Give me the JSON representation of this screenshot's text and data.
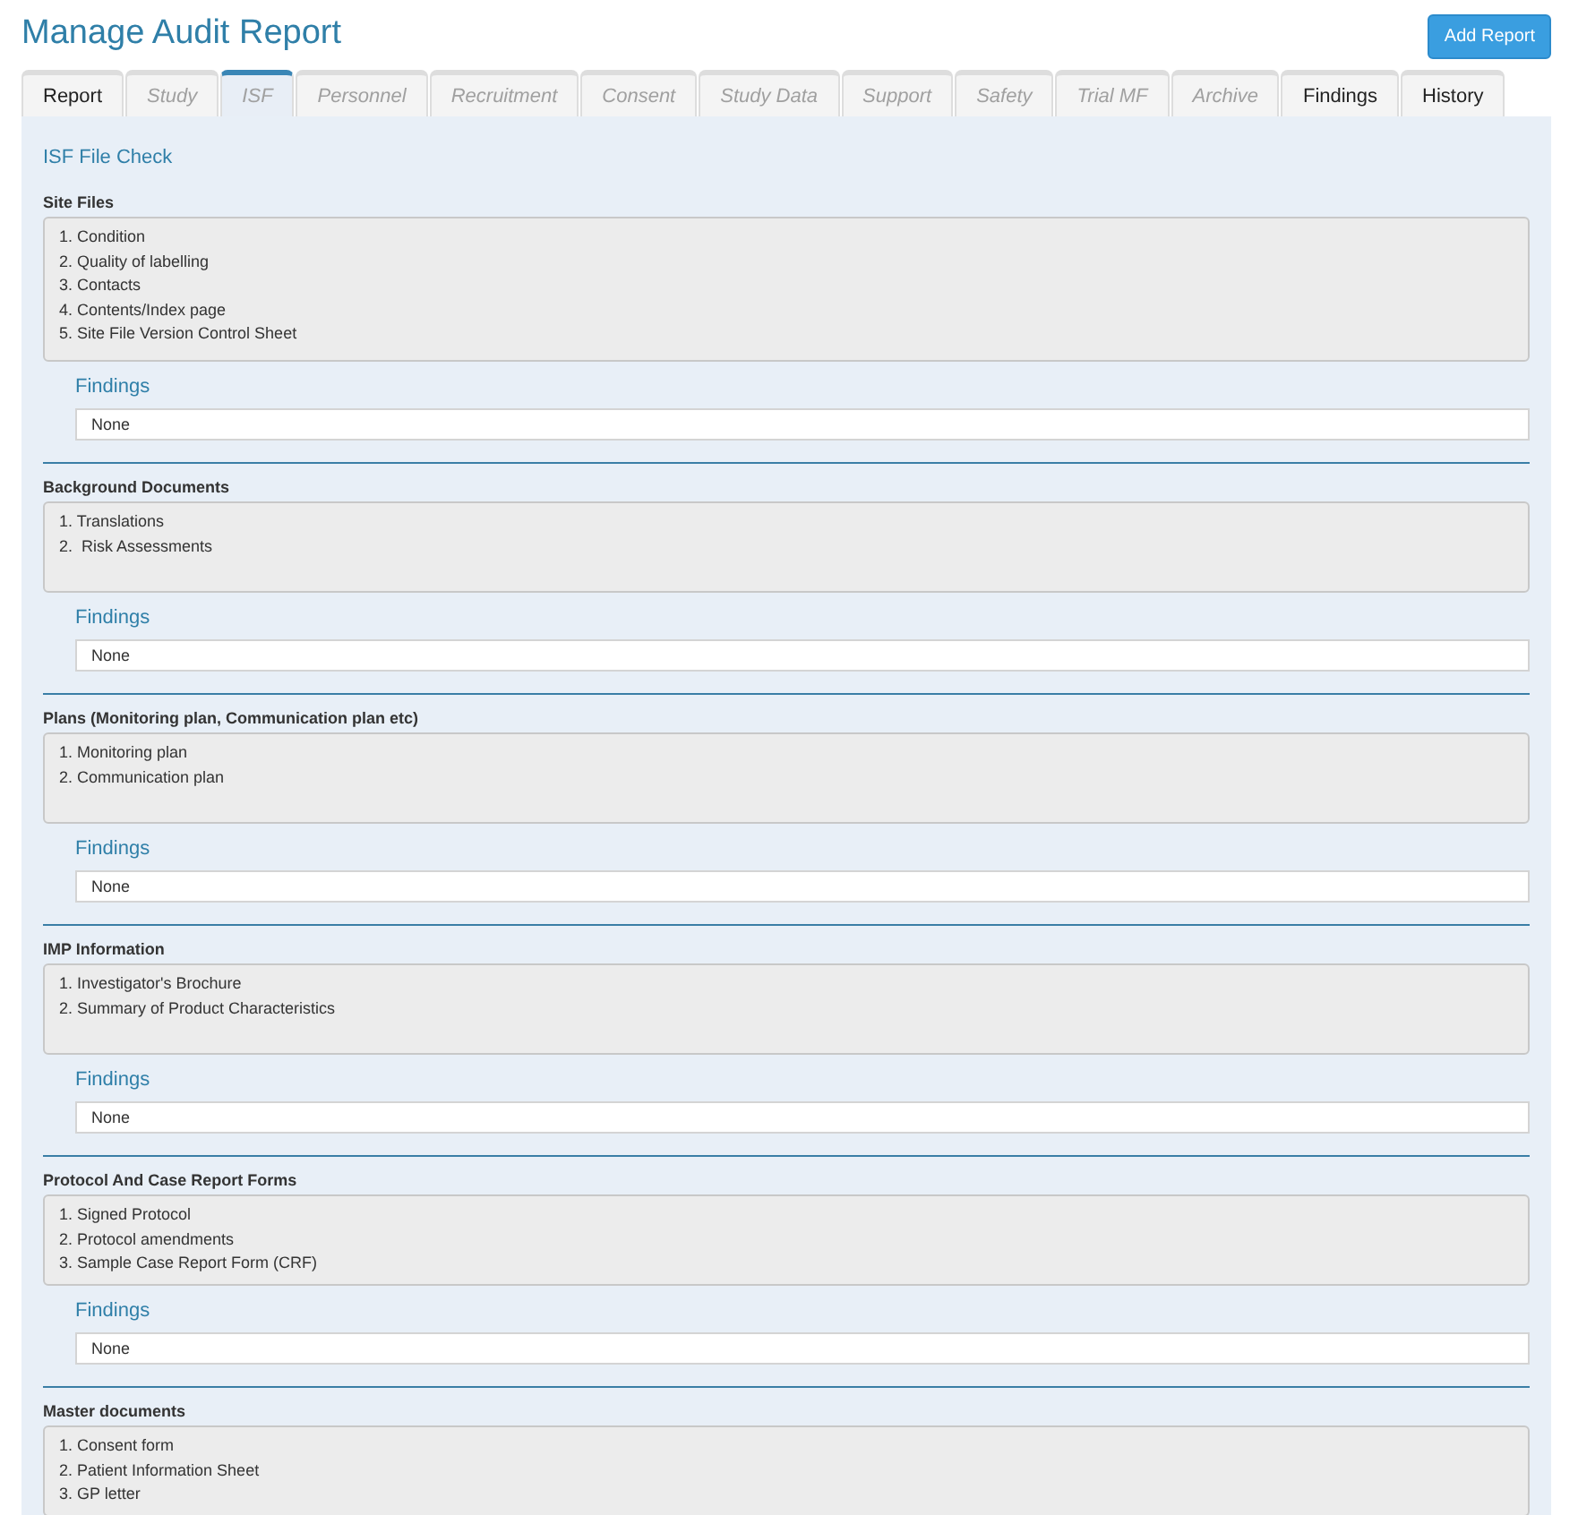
{
  "page_title": "Manage Audit Report",
  "add_button": "Add Report",
  "tabs": [
    {
      "label": "Report",
      "selected": false,
      "disabled": false
    },
    {
      "label": "Study",
      "selected": false,
      "disabled": true
    },
    {
      "label": "ISF",
      "selected": true,
      "disabled": true
    },
    {
      "label": "Personnel",
      "selected": false,
      "disabled": true
    },
    {
      "label": "Recruitment",
      "selected": false,
      "disabled": true
    },
    {
      "label": "Consent",
      "selected": false,
      "disabled": true
    },
    {
      "label": "Study Data",
      "selected": false,
      "disabled": true
    },
    {
      "label": "Support",
      "selected": false,
      "disabled": true
    },
    {
      "label": "Safety",
      "selected": false,
      "disabled": true
    },
    {
      "label": "Trial MF",
      "selected": false,
      "disabled": true
    },
    {
      "label": "Archive",
      "selected": false,
      "disabled": true
    },
    {
      "label": "Findings",
      "selected": false,
      "disabled": false
    },
    {
      "label": "History",
      "selected": false,
      "disabled": false
    }
  ],
  "panel_title": "ISF File Check",
  "sections": [
    {
      "heading": "Site Files",
      "items": [
        "1. Condition",
        "2. Quality of labelling",
        "3. Contacts",
        "4. Contents/Index page",
        "5. Site File Version Control Sheet"
      ],
      "findings_label": "Findings",
      "findings_value": "None"
    },
    {
      "heading": "Background Documents",
      "items": [
        "1. Translations",
        "2.  Risk Assessments"
      ],
      "findings_label": "Findings",
      "findings_value": "None"
    },
    {
      "heading": "Plans (Monitoring plan, Communication plan etc)",
      "items": [
        "1. Monitoring plan",
        "2. Communication plan"
      ],
      "findings_label": "Findings",
      "findings_value": "None"
    },
    {
      "heading": "IMP Information",
      "items": [
        "1. Investigator's Brochure",
        "2. Summary of Product Characteristics"
      ],
      "findings_label": "Findings",
      "findings_value": "None"
    },
    {
      "heading": "Protocol And Case Report Forms",
      "items": [
        "1. Signed Protocol",
        "2. Protocol amendments",
        "3. Sample Case Report Form (CRF)"
      ],
      "findings_label": "Findings",
      "findings_value": "None"
    },
    {
      "heading": "Master documents",
      "items": [
        "1. Consent form",
        "2. Patient Information Sheet",
        "3. GP letter"
      ]
    }
  ]
}
